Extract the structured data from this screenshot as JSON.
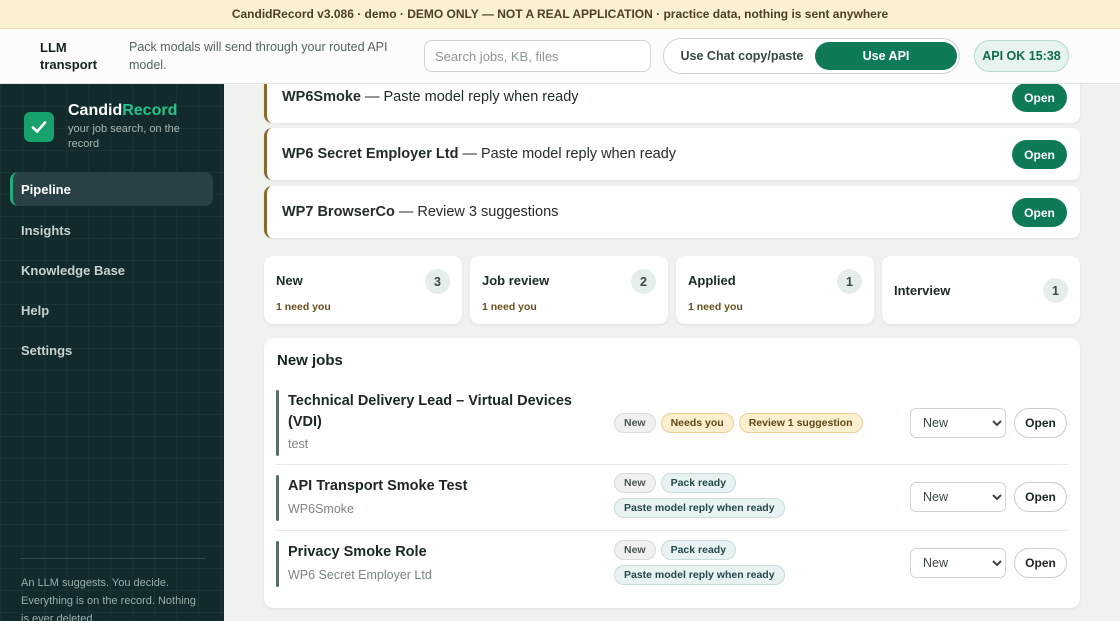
{
  "banner": {
    "text": "CandidRecord v3.086 · demo · DEMO ONLY — NOT A REAL APPLICATION · practice data, nothing is sent anywhere"
  },
  "transport": {
    "title": "LLM transport",
    "note": "Pack modals will send through your routed API model.",
    "search_placeholder": "Search jobs, KB, files",
    "chat_label": "Use Chat copy/paste",
    "api_label": "Use API",
    "status": "API OK 15:38"
  },
  "sidebar": {
    "brand_part1": "Candid",
    "brand_part2": "Record",
    "tagline": "your job search, on the record",
    "nav": [
      {
        "label": "Pipeline",
        "active": true
      },
      {
        "label": "Insights"
      },
      {
        "label": "Knowledge Base"
      },
      {
        "label": "Help"
      },
      {
        "label": "Settings"
      }
    ],
    "footer": "An LLM suggests. You decide. Everything is on the record. Nothing is ever deleted."
  },
  "queue": [
    {
      "company": "WP6Smoke",
      "message": "— Paste model reply when ready",
      "action": "Open"
    },
    {
      "company": "WP6 Secret Employer Ltd",
      "message": "— Paste model reply when ready",
      "action": "Open"
    },
    {
      "company": "WP7 BrowserCo",
      "message": "— Review 3 suggestions",
      "action": "Open"
    }
  ],
  "stats": [
    {
      "label": "New",
      "count": "3",
      "sub": "1 need you"
    },
    {
      "label": "Job review",
      "count": "2",
      "sub": "1 need you"
    },
    {
      "label": "Applied",
      "count": "1",
      "sub": "1 need you"
    },
    {
      "label": "Interview",
      "count": "1",
      "sub": ""
    }
  ],
  "jobs": {
    "title": "New jobs",
    "open_label": "Open",
    "status_options": [
      "New"
    ],
    "rows": [
      {
        "title": "Technical Delivery Lead – Virtual Devices (VDI)",
        "company": "test",
        "status": "New",
        "badges": [
          {
            "text": "New",
            "kind": "new"
          },
          {
            "text": "Needs you",
            "kind": "amber"
          },
          {
            "text": "Review 1 suggestion",
            "kind": "amber"
          }
        ]
      },
      {
        "title": "API Transport Smoke Test",
        "company": "WP6Smoke",
        "status": "New",
        "badges": [
          {
            "text": "New",
            "kind": "new"
          },
          {
            "text": "Pack ready",
            "kind": "info"
          },
          {
            "text": "Paste model reply when ready",
            "kind": "info"
          }
        ]
      },
      {
        "title": "Privacy Smoke Role",
        "company": "WP6 Secret Employer Ltd",
        "status": "New",
        "badges": [
          {
            "text": "New",
            "kind": "new"
          },
          {
            "text": "Pack ready",
            "kind": "info"
          },
          {
            "text": "Paste model reply when ready",
            "kind": "info"
          }
        ]
      }
    ]
  },
  "colors": {
    "accent": "#0f7a58",
    "sidebar_bg": "#122a2c",
    "brand_green": "#22c48b",
    "queue_border": "#8a6a2e",
    "banner_bg": "#fbf0cf"
  },
  "icons": {
    "logo": "check-icon",
    "select": "chevron-down-icon"
  }
}
